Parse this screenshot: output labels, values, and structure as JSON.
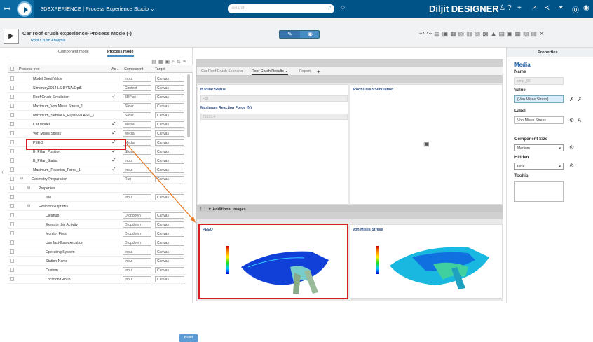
{
  "topbar": {
    "brand_mark": "3ds",
    "app_name": "3DEXPERIENCE | Process Experience Studio ⌄",
    "search_placeholder": "Search",
    "user_name": "Diljit DESIGNER",
    "icons": [
      "search-icon",
      "tag-icon",
      "user-icon",
      "share-icon",
      "add-icon",
      "collaborate-icon",
      "community-icon",
      "help-icon",
      "compass-icon"
    ]
  },
  "header": {
    "title": "Car roof crush experience-Process Mode (-)",
    "subtitle": "Roof Crush Analysis",
    "toolbar_icons": [
      "undo",
      "redo",
      "copy",
      "paste",
      "save",
      "publish",
      "delete",
      "lock",
      "grid",
      "close"
    ]
  },
  "left_panel": {
    "tabs": [
      "Component mode",
      "Process mode"
    ],
    "active_tab": 1,
    "columns": [
      "Process tree",
      "Ac...",
      "Component",
      "Target"
    ],
    "rows": [
      {
        "name": "Model Seed Value",
        "check": "",
        "component": "Input",
        "target": "Canvas",
        "indent": 1
      },
      {
        "name": "Simerudy2014 LS DYNA/Opt5",
        "check": "",
        "component": "Content",
        "target": "Canvas",
        "indent": 1
      },
      {
        "name": "Roof Crush Simulation",
        "check": "✓",
        "component": "3DPlav",
        "target": "Canvas",
        "indent": 1
      },
      {
        "name": "Maximum_Von Mises Stress_1",
        "check": "",
        "component": "Slider",
        "target": "Canvas",
        "indent": 1
      },
      {
        "name": "Maximum_Sensor 6_EQUIVPLAST_1",
        "check": "",
        "component": "Slider",
        "target": "Canvas",
        "indent": 1
      },
      {
        "name": "Car Model",
        "check": "✓",
        "component": "Media",
        "target": "Canvas",
        "indent": 1
      },
      {
        "name": "Von Mises Stress",
        "check": "✓",
        "component": "Media",
        "target": "Canvas",
        "indent": 1
      },
      {
        "name": "PEEQ",
        "check": "✓",
        "component": "Media",
        "target": "Canvas",
        "indent": 1
      },
      {
        "name": "B_Pillar_Position",
        "check": "✓",
        "component": "Slider",
        "target": "Canvas",
        "indent": 1
      },
      {
        "name": "B_Pillar_Status",
        "check": "✓",
        "component": "Input",
        "target": "Canvas",
        "indent": 1
      },
      {
        "name": "Maximum_Reaction_Force_1",
        "check": "✓",
        "component": "Input",
        "target": "Canvas",
        "indent": 1
      },
      {
        "name": "Geometry Preparation",
        "check": "",
        "component": "Run",
        "target": "Canvas",
        "indent": 2,
        "toggle": "⊟"
      },
      {
        "name": "Properties",
        "check": "",
        "component": "",
        "target": "",
        "indent": 3,
        "toggle": "⊞"
      },
      {
        "name": "title",
        "check": "",
        "component": "Input",
        "target": "Canvas",
        "indent": 4
      },
      {
        "name": "Execution Options",
        "check": "",
        "component": "",
        "target": "",
        "indent": 3,
        "toggle": "⊟"
      },
      {
        "name": "Cleanup",
        "check": "",
        "component": "Dropdown",
        "target": "Canvas",
        "indent": 4
      },
      {
        "name": "Execute this Activity",
        "check": "",
        "component": "Dropdown",
        "target": "Canvas",
        "indent": 4
      },
      {
        "name": "Monitor Files",
        "check": "",
        "component": "Dropdown",
        "target": "Canvas",
        "indent": 4
      },
      {
        "name": "Use fast-flow execution",
        "check": "",
        "component": "Dropdown",
        "target": "Canvas",
        "indent": 4
      },
      {
        "name": "Operating System",
        "check": "",
        "component": "Input",
        "target": "Canvas",
        "indent": 4
      },
      {
        "name": "Station Name",
        "check": "",
        "component": "Input",
        "target": "Canvas",
        "indent": 4
      },
      {
        "name": "Custom",
        "check": "",
        "component": "Input",
        "target": "Canvas",
        "indent": 4
      },
      {
        "name": "Location Group",
        "check": "",
        "component": "Input",
        "target": "Canvas",
        "indent": 4
      }
    ],
    "build_label": "Build"
  },
  "canvas": {
    "tabs": [
      "Car Roof Crush Scenario",
      "Roof Crush Results ⌄",
      "Report"
    ],
    "active_tab": 1,
    "b_pillar_status_label": "B Pillar Status",
    "b_pillar_status_value": "Fail",
    "max_reaction_label": "Maximum Reaction Force (N)",
    "max_reaction_value": "71693.4",
    "roof_sim_label": "Roof Crush Simulation",
    "additional_images_label": "Additional Images",
    "image1_title": "PEEQ",
    "image2_title": "Von Mises Stress"
  },
  "properties": {
    "tab_label": "Properties",
    "heading": "Media",
    "name_label": "Name",
    "name_value": "cmp_86",
    "value_label": "Value",
    "value_value": "{Von Mises Stress}",
    "label_label": "Label",
    "label_value": "Von Mises Stress",
    "size_label": "Component Size",
    "size_value": "Medium",
    "hidden_label": "Hidden",
    "hidden_value": "false",
    "tooltip_label": "Tooltip"
  }
}
